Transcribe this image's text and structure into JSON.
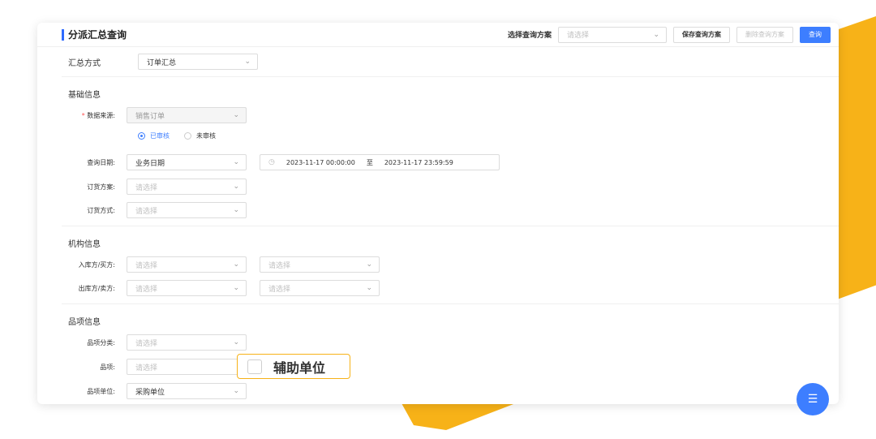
{
  "header": {
    "title": "分派汇总查询",
    "plan_label": "选择查询方案",
    "plan_placeholder": "请选择",
    "save_plan": "保存查询方案",
    "delete_plan": "删除查询方案",
    "query": "查询"
  },
  "summary": {
    "label": "汇总方式",
    "value": "订单汇总"
  },
  "basic": {
    "title": "基础信息",
    "source_label": "数据来源:",
    "source_value": "销售订单",
    "radio_audited": "已审核",
    "radio_unaudited": "未审核",
    "date_label": "查询日期:",
    "date_type": "业务日期",
    "date_start": "2023-11-17 00:00:00",
    "date_sep": "至",
    "date_end": "2023-11-17 23:59:59",
    "order_plan_label": "订货方案:",
    "order_mode_label": "订货方式:",
    "placeholder": "请选择"
  },
  "org": {
    "title": "机构信息",
    "in_label": "入库方/买方:",
    "out_label": "出库方/卖方:",
    "placeholder": "请选择"
  },
  "item": {
    "title": "品项信息",
    "category_label": "品项分类:",
    "item_label": "品项:",
    "unit_label": "品项单位:",
    "unit_value": "采购单位",
    "placeholder": "请选择",
    "aux_unit": "辅助单位"
  },
  "colors": {
    "accent": "#3d7eff",
    "highlight": "#f7b218"
  }
}
